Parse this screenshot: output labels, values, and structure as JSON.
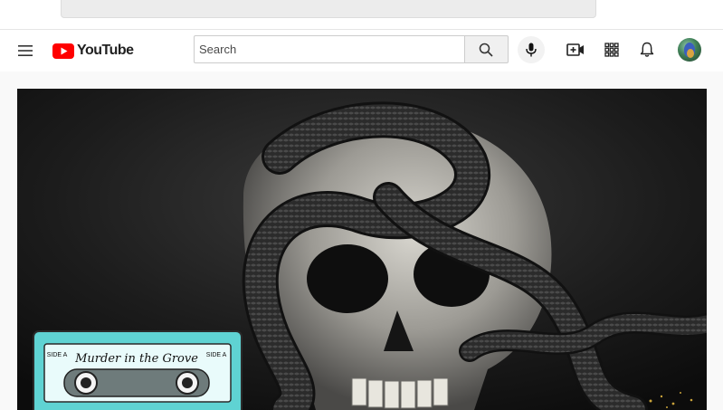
{
  "masthead": {
    "logo_text": "YouTube",
    "search": {
      "placeholder": "Search",
      "value": ""
    },
    "icons": {
      "menu": "hamburger-menu-icon",
      "search": "search-icon",
      "mic": "microphone-icon",
      "create": "create-video-icon",
      "apps": "apps-grid-icon",
      "notifications": "bell-icon",
      "avatar": "account-avatar"
    }
  },
  "video": {
    "thumbnail": {
      "cassette_title": "Murder in the Grove",
      "side_left": "SIDE A",
      "side_right": "SIDE A"
    }
  },
  "colors": {
    "brand_red": "#ff0000",
    "cassette_teal": "#5fd3d3",
    "masthead_bg": "#ffffff"
  }
}
